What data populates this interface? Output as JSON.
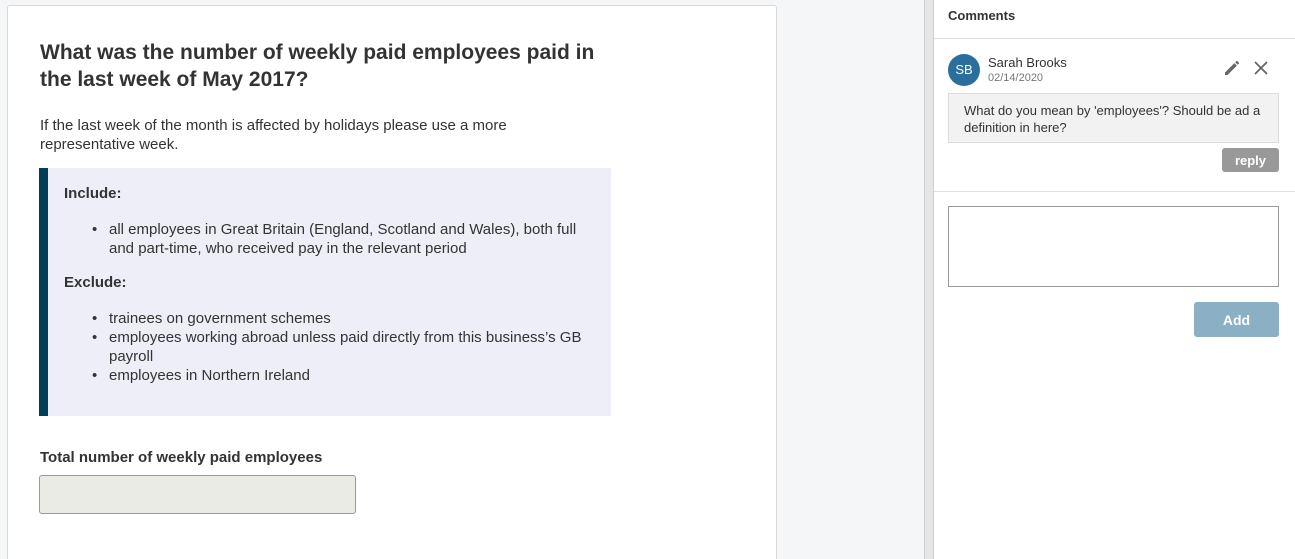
{
  "question": {
    "title": "What was the number of weekly paid employees paid in the last week of May 2017?",
    "description": "If the last week of the month is affected by holidays please use a more representative week.",
    "guidance": {
      "include_heading": "Include:",
      "include_items": [
        "all employees in Great Britain (England, Scotland and Wales), both full and part-time, who received pay in the relevant period"
      ],
      "exclude_heading": "Exclude:",
      "exclude_items": [
        "trainees on government schemes",
        "employees working abroad unless paid directly from this business’s GB payroll",
        "employees in Northern Ireland"
      ]
    },
    "answer": {
      "label": "Total number of weekly paid employees",
      "value": ""
    }
  },
  "comments": {
    "title": "Comments",
    "items": [
      {
        "initials": "SB",
        "author": "Sarah Brooks",
        "date": "02/14/2020",
        "text": "What do you mean by 'employees'? Should be ad a definition in here?",
        "reply_label": "reply",
        "edit_icon": "pencil-icon",
        "delete_icon": "close-icon"
      }
    ],
    "new_comment_value": "",
    "add_label": "Add"
  },
  "colors": {
    "guidance_border": "#033e58",
    "guidance_background": "#eeeef9",
    "avatar": "#2a6f9b",
    "add_button": "#8bafc5",
    "reply_button": "#999999",
    "answer_input_background": "#ebebe6"
  }
}
